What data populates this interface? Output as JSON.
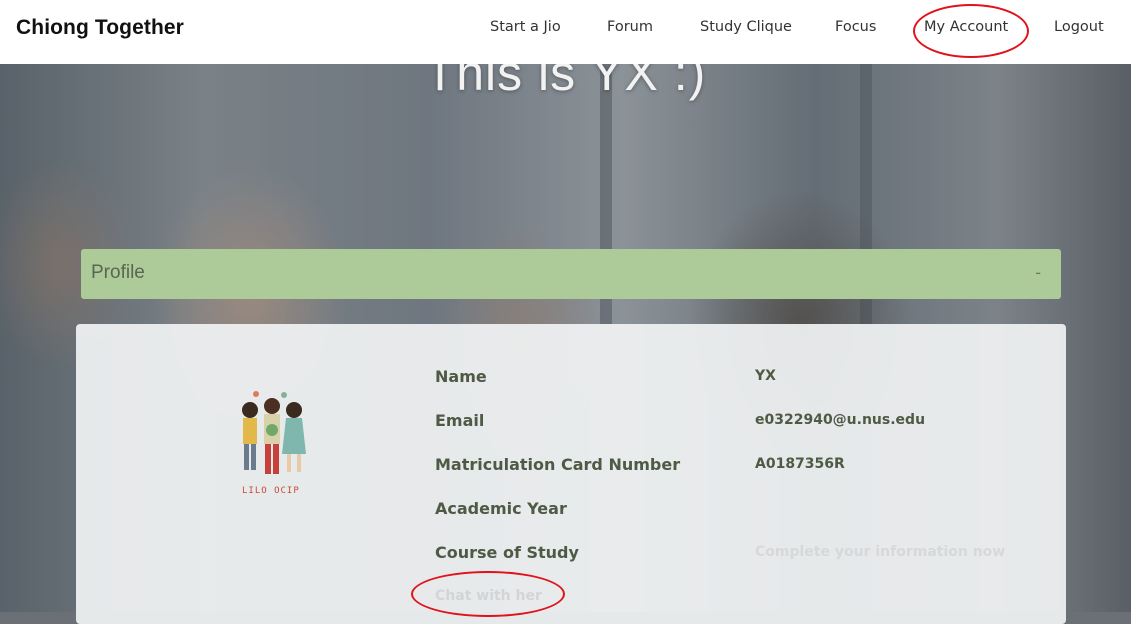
{
  "brand": "Chiong Together",
  "nav": {
    "items": [
      "Start a Jio",
      "Forum",
      "Study Clique",
      "Focus",
      "My Account",
      "Logout"
    ]
  },
  "hero": {
    "title": "This is YX :)"
  },
  "profile": {
    "header": "Profile",
    "toggle": "-",
    "avatar_caption": "LILO OCIP",
    "fields": [
      {
        "label": "Name",
        "value": "YX"
      },
      {
        "label": "Email",
        "value": "e0322940@u.nus.edu"
      },
      {
        "label": "Matriculation Card Number",
        "value": "A0187356R"
      },
      {
        "label": "Academic Year",
        "value": ""
      },
      {
        "label": "Course of Study",
        "value": "Complete your information now"
      }
    ],
    "chat_link": "Chat with her"
  },
  "colors": {
    "accent_green": "#adcb98",
    "label_text": "#4f5a45",
    "annotation_red": "#e0121b"
  }
}
